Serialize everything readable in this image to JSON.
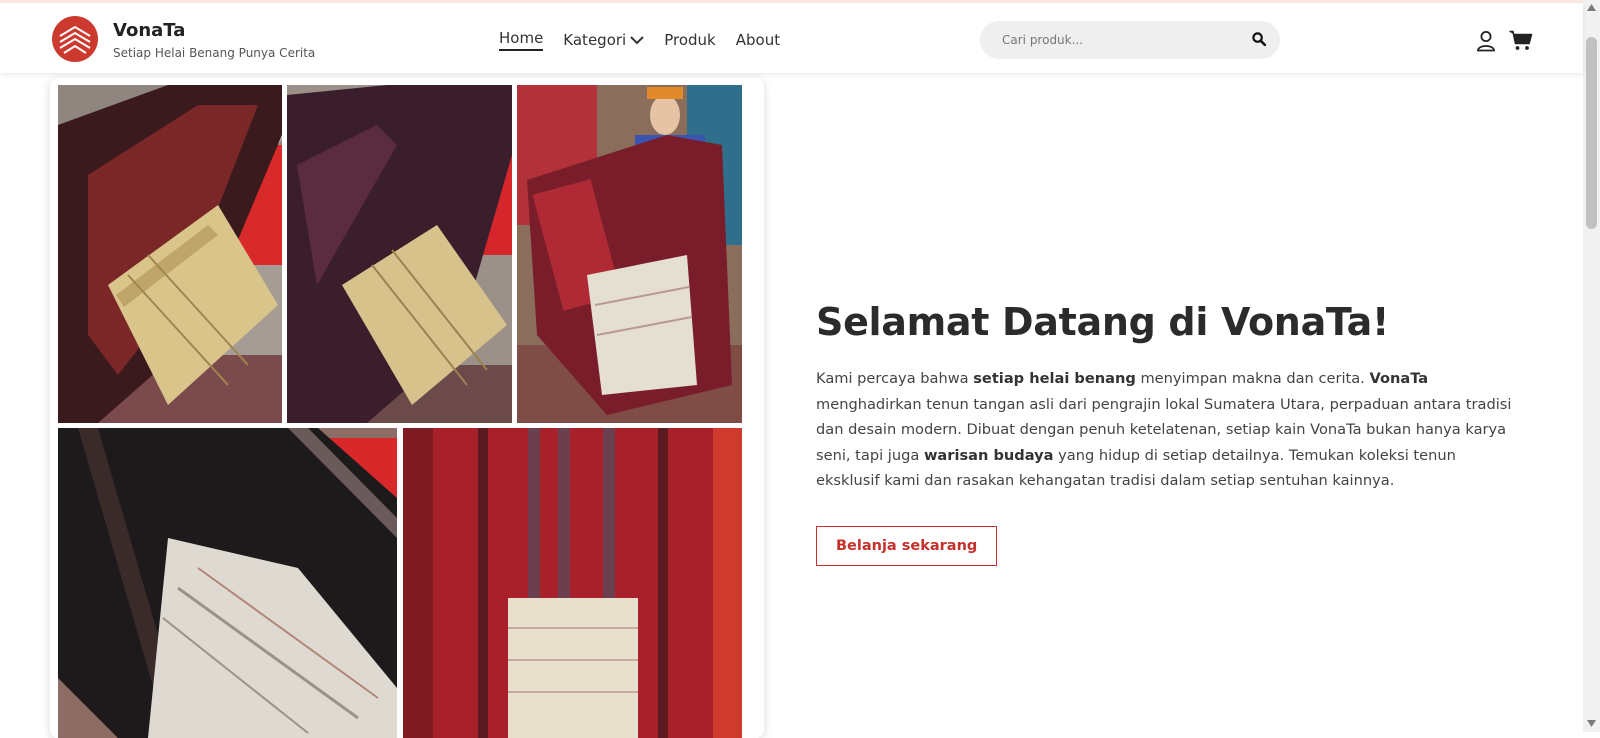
{
  "brand": {
    "name": "VonaTa",
    "tagline": "Setiap Helai Benang Punya Cerita",
    "color": "#cc3a2f"
  },
  "nav": {
    "items": [
      {
        "label": "Home",
        "active": true
      },
      {
        "label": "Kategori",
        "has_dropdown": true
      },
      {
        "label": "Produk"
      },
      {
        "label": "About"
      }
    ]
  },
  "search": {
    "placeholder": "Cari produk...",
    "value": "",
    "icon": "search-icon"
  },
  "header_icons": [
    "user-icon",
    "cart-icon"
  ],
  "hero": {
    "title": "Selamat Datang di VonaTa!",
    "description": [
      {
        "text": "Kami percaya bahwa "
      },
      {
        "text": "setiap helai benang",
        "bold": true
      },
      {
        "text": " menyimpan makna dan cerita. "
      },
      {
        "text": "VonaTa",
        "bold": true
      },
      {
        "text": " menghadirkan tenun tangan asli dari pengrajin lokal Sumatera Utara, perpaduan antara tradisi dan desain modern. Dibuat dengan penuh ketelatenan, setiap kain VonaTa bukan hanya karya seni, tapi juga "
      },
      {
        "text": "warisan budaya",
        "bold": true
      },
      {
        "text": " yang hidup di setiap detailnya. Temukan koleksi tenun eksklusif kami dan rasakan kehangatan tradisi dalam setiap sentuhan kainnya."
      }
    ],
    "cta_label": "Belanja sekarang",
    "accent_color": "#c6302a"
  },
  "gallery": {
    "photos": [
      {
        "name": "dark maroon ulos on mannequin",
        "main": "#3a1a1c",
        "panel": "#d9c58a"
      },
      {
        "name": "purple ulos on mannequin",
        "main": "#3b1e2c",
        "panel": "#d8c28c"
      },
      {
        "name": "woman holding maroon ulos",
        "main": "#7a1d2a",
        "panel": "#e5dfd2"
      },
      {
        "name": "black ulos with white panel",
        "main": "#1c1a1a",
        "panel": "#dedad2"
      },
      {
        "name": "red ulos with white panel",
        "main": "#a8202a",
        "panel": "#e7e0cc"
      }
    ]
  }
}
